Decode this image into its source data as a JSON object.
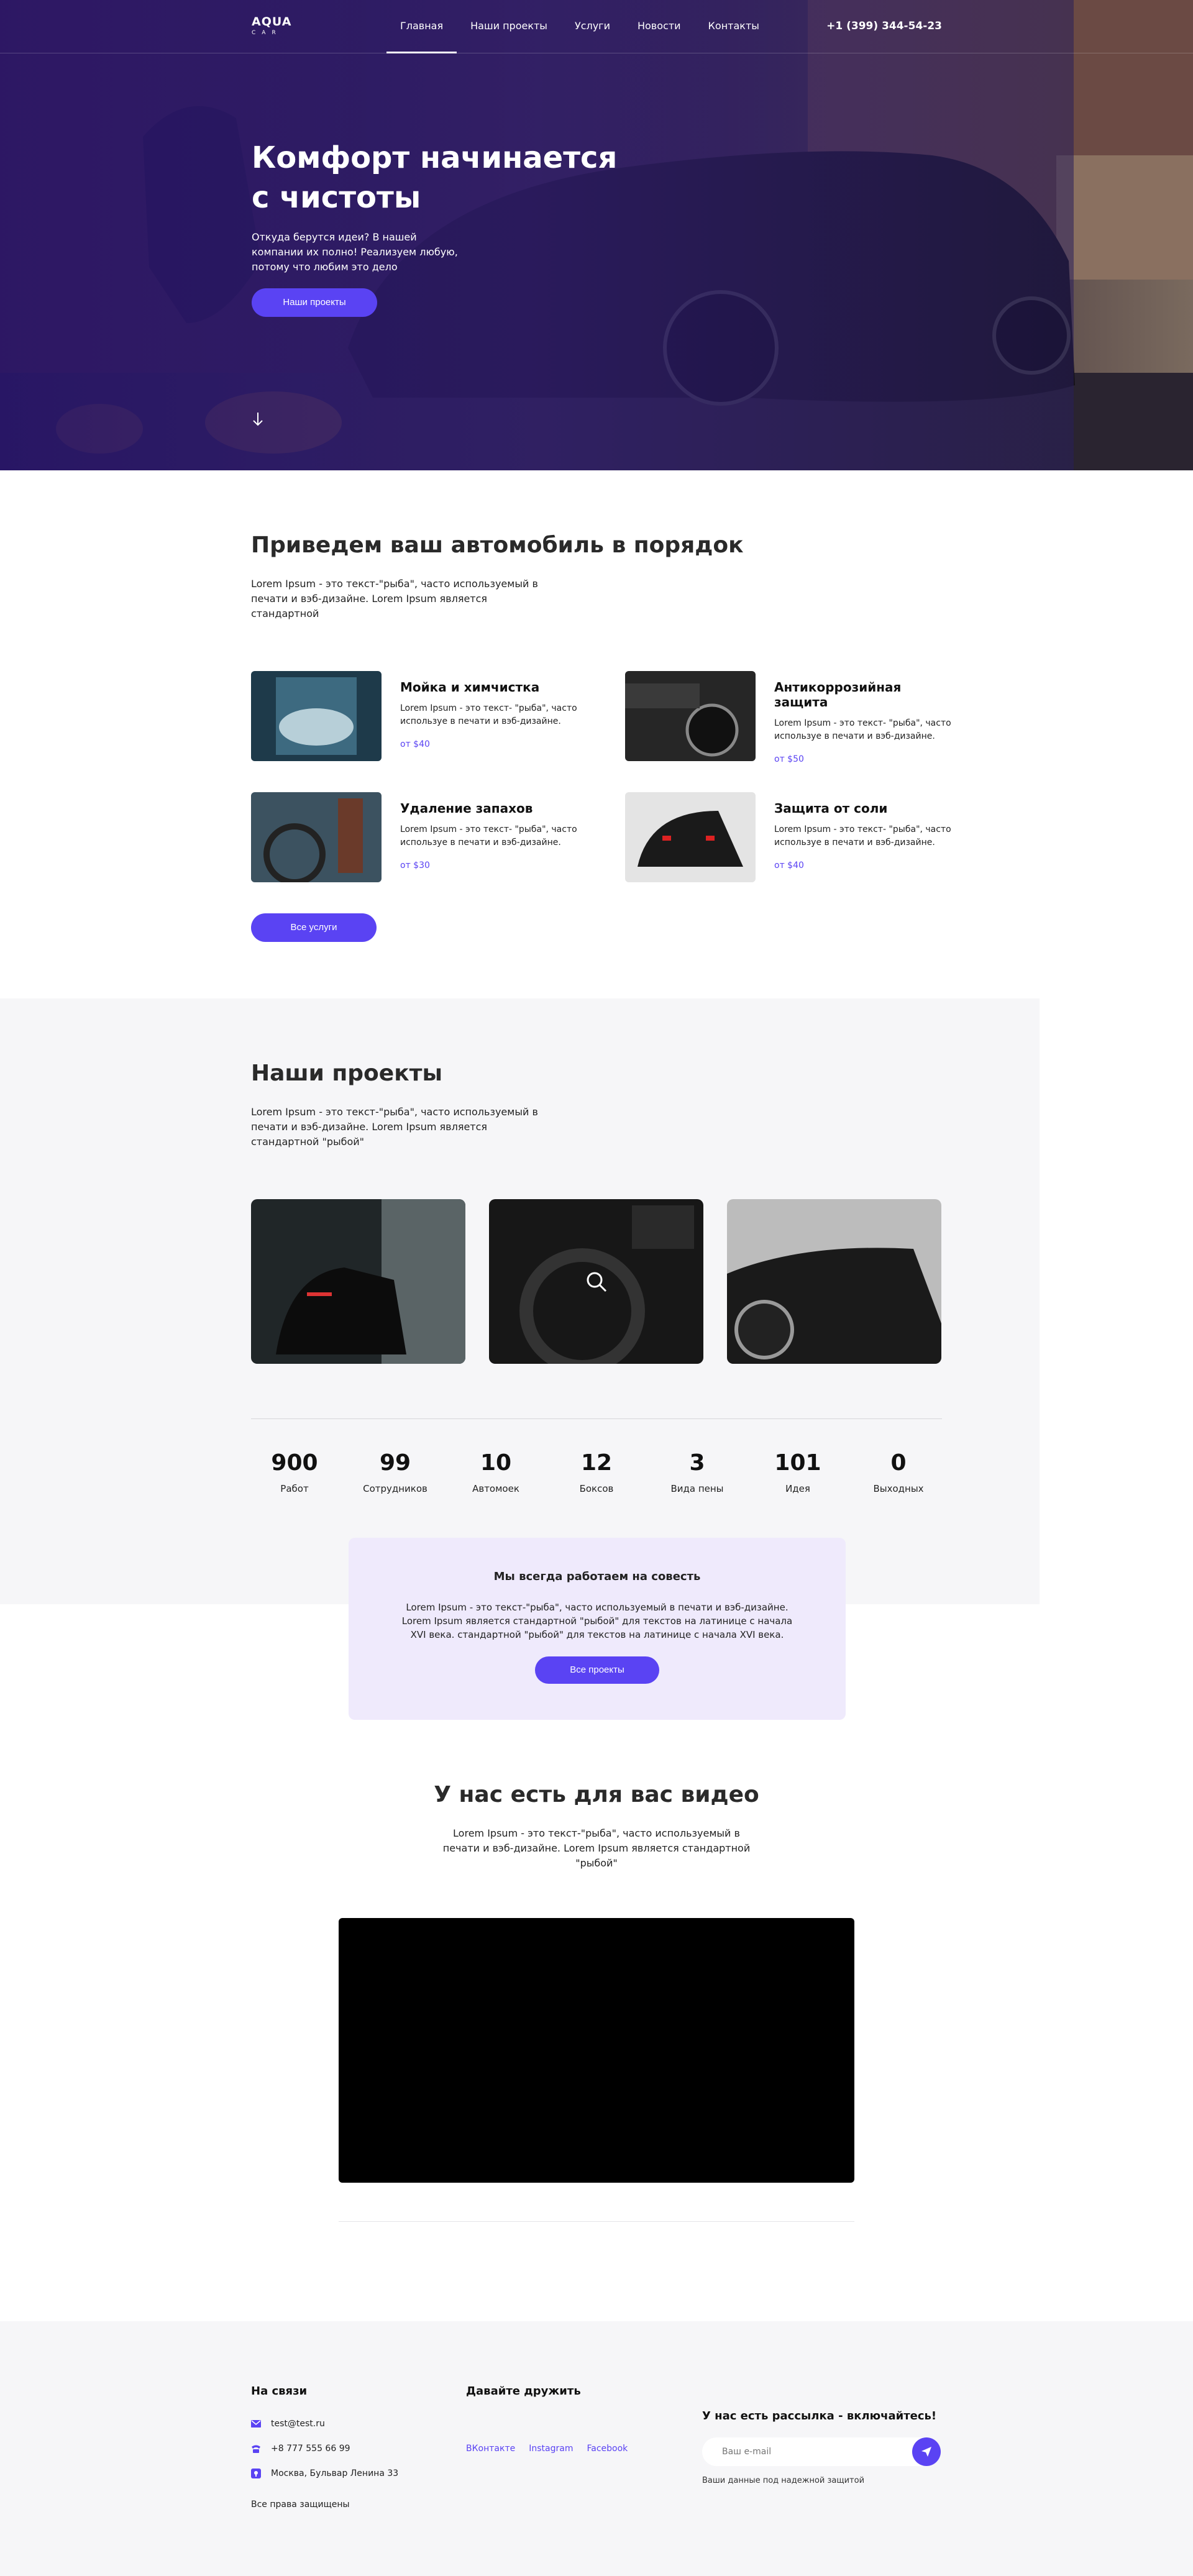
{
  "header": {
    "logo_main": "AQUA",
    "logo_sub": "CAR",
    "nav": [
      {
        "label": "Главная"
      },
      {
        "label": "Наши проекты"
      },
      {
        "label": "Услуги"
      },
      {
        "label": "Новости"
      },
      {
        "label": "Контакты"
      }
    ],
    "phone": "+1 (399) 344-54-23"
  },
  "hero": {
    "title": "Комфорт начинается с чистоты",
    "text": "Откуда берутся идеи? В нашей компании их полно! Реализуем любую, потому что любим это дело",
    "button": "Наши проекты"
  },
  "services": {
    "title": "Приведем ваш автомобиль в порядок",
    "lead": "Lorem Ipsum - это текст-\"рыба\", часто используемый в печати и вэб-дизайне. Lorem Ipsum является стандартной",
    "items": [
      {
        "title": "Мойка и химчистка",
        "desc": "Lorem Ipsum - это текст- \"рыба\", часто используе в печати и вэб-дизайне.",
        "price": "от $40"
      },
      {
        "title": "Антикоррозийная защита",
        "desc": "Lorem Ipsum - это текст- \"рыба\", часто используе в печати и вэб-дизайне.",
        "price": "от $50"
      },
      {
        "title": "Удаление запахов",
        "desc": "Lorem Ipsum - это текст- \"рыба\", часто используе в печати и вэб-дизайне.",
        "price": "от $30"
      },
      {
        "title": "Защита от соли",
        "desc": "Lorem Ipsum - это текст- \"рыба\", часто используе в печати и вэб-дизайне.",
        "price": "от $40"
      }
    ],
    "button": "Все услуги"
  },
  "projects": {
    "title": "Наши проекты",
    "lead": "Lorem Ipsum - это текст-\"рыба\", часто используемый в печати и вэб-дизайне. Lorem Ipsum является стандартной \"рыбой\"",
    "stats": [
      {
        "num": "900",
        "label": "Работ"
      },
      {
        "num": "99",
        "label": "Сотрудников"
      },
      {
        "num": "10",
        "label": "Автомоек"
      },
      {
        "num": "12",
        "label": "Боксов"
      },
      {
        "num": "3",
        "label": "Вида пены"
      },
      {
        "num": "101",
        "label": "Идея"
      },
      {
        "num": "0",
        "label": "Выходных"
      }
    ]
  },
  "notice": {
    "title": "Мы всегда работаем на совесть",
    "text": "Lorem Ipsum - это текст-\"рыба\", часто используемый в печати и вэб-дизайне. Lorem Ipsum является стандартной \"рыбой\" для текстов на латинице с начала XVI века.  стандартной \"рыбой\" для текстов на латинице с начала XVI века.",
    "button": "Все проекты"
  },
  "video": {
    "title": "У нас есть для вас видео",
    "lead": "Lorem Ipsum - это текст-\"рыба\", часто используемый в печати и вэб-дизайне. Lorem Ipsum является стандартной \"рыбой\""
  },
  "footer": {
    "contacts_title": "На связи",
    "email": "test@test.ru",
    "phone": "+8 777 555 66 99",
    "address": "Москва, Бульвар Ленина 33",
    "rights": "Все права защищены",
    "social_title": "Давайте дружить",
    "social": [
      {
        "label": "ВКонтакте"
      },
      {
        "label": "Instagram"
      },
      {
        "label": "Facebook"
      }
    ],
    "subscribe_title": "У нас есть рассылка - включайтесь!",
    "subscribe_placeholder": "Ваш e-mail",
    "subscribe_note": "Ваши данные под надежной защитой"
  },
  "colors": {
    "accent": "#5a43f3",
    "light_bg": "#f6f6f8",
    "notice_bg": "#efeafc"
  }
}
